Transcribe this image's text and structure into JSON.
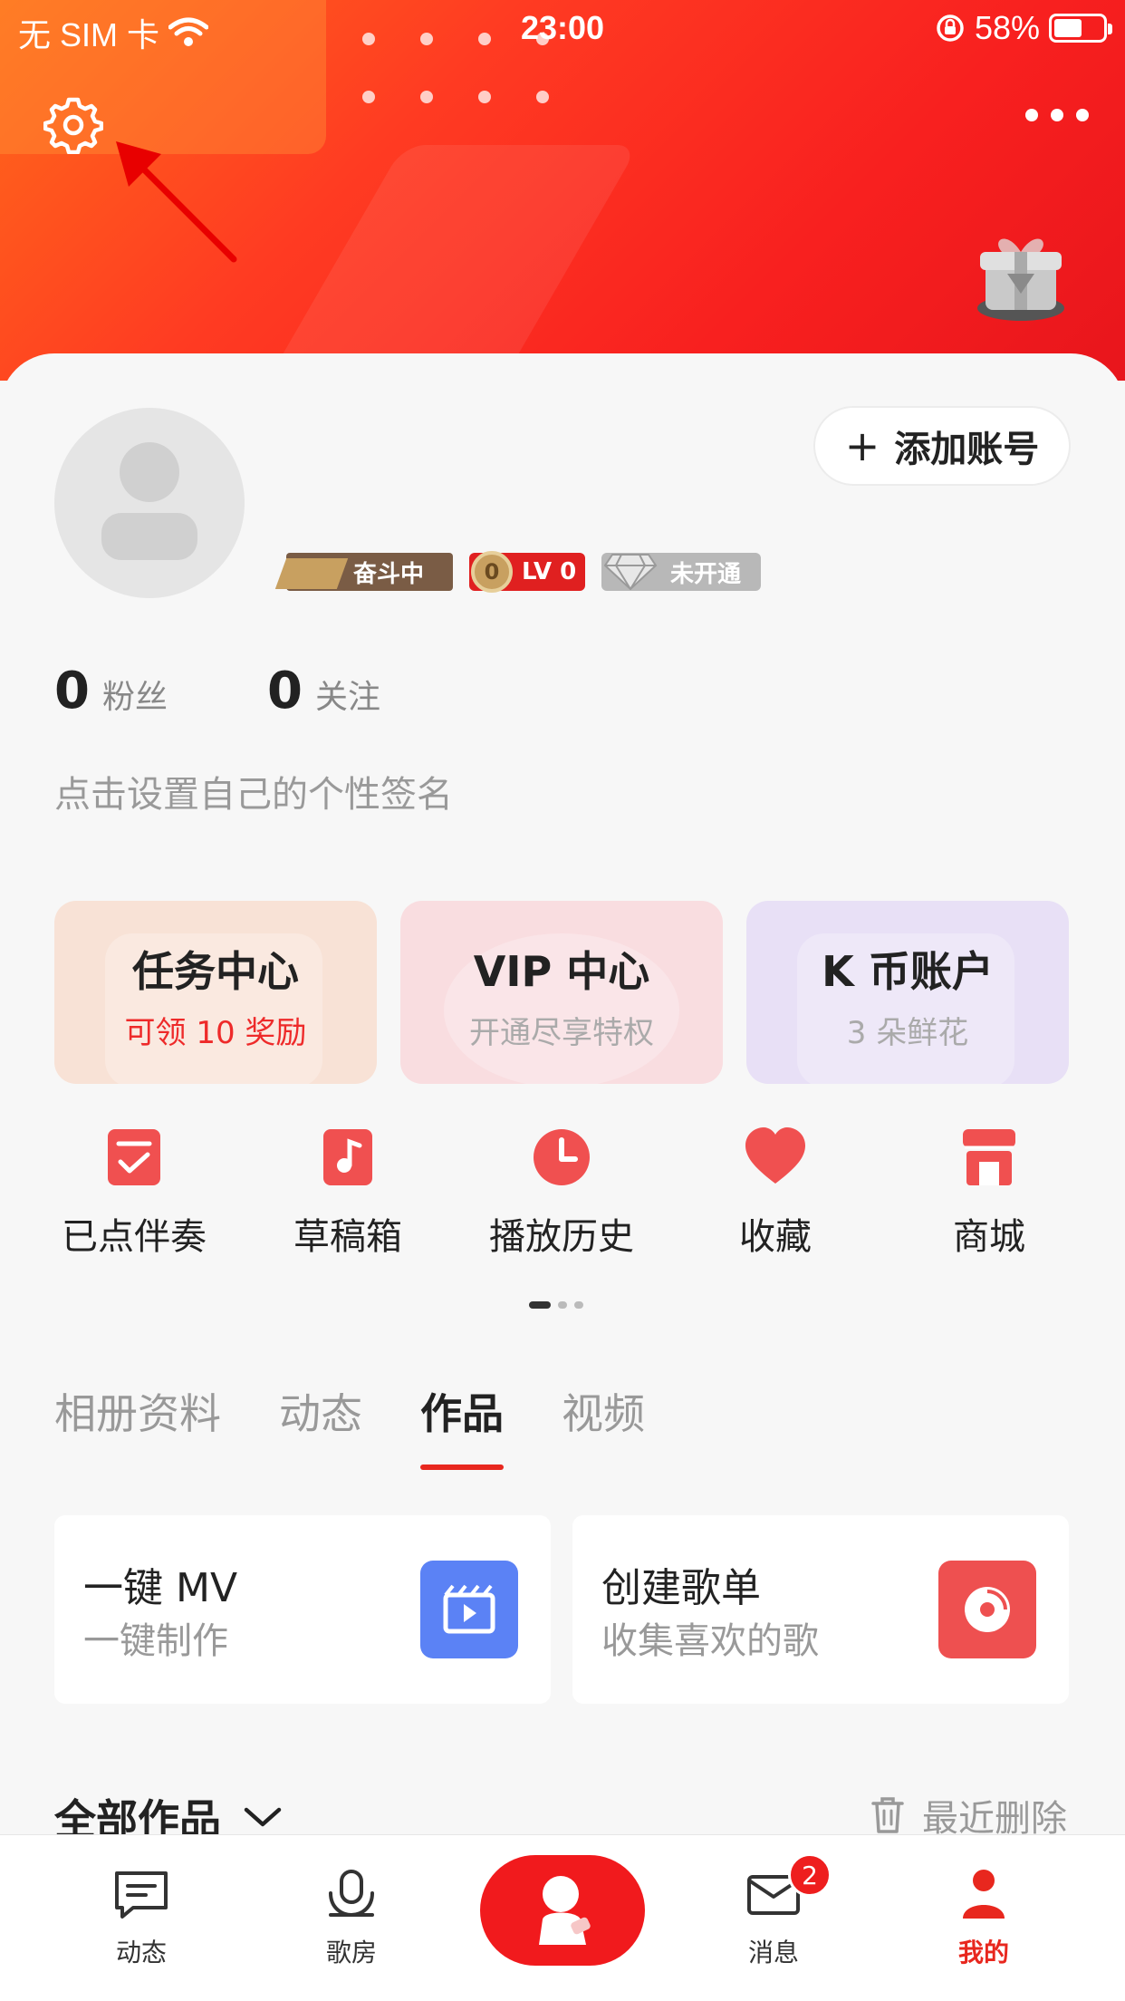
{
  "status_bar": {
    "carrier": "无 SIM 卡",
    "time": "23:00",
    "battery": "58%",
    "battery_level": 0.58
  },
  "profile": {
    "add_account": "添加账号",
    "badges": {
      "rank": "奋斗中",
      "level": "LV 0",
      "coin": "0",
      "vip": "未开通"
    },
    "stats": [
      {
        "value": "0",
        "label": "粉丝"
      },
      {
        "value": "0",
        "label": "关注"
      }
    ],
    "signature": "点击设置自己的个性签名"
  },
  "tiles": [
    {
      "title": "任务中心",
      "subtitle": "可领 10 奖励"
    },
    {
      "title": "VIP 中心",
      "subtitle": "开通尽享特权"
    },
    {
      "title": "K 币账户",
      "subtitle": "3 朵鲜花"
    }
  ],
  "shortcuts": [
    "已点伴奏",
    "草稿箱",
    "播放历史",
    "收藏",
    "商城"
  ],
  "tabs": [
    "相册资料",
    "动态",
    "作品",
    "视频"
  ],
  "actions": [
    {
      "title": "一键 MV",
      "subtitle": "一键制作"
    },
    {
      "title": "创建歌单",
      "subtitle": "收集喜欢的歌"
    }
  ],
  "works": {
    "title": "全部作品",
    "recent_deleted": "最近删除"
  },
  "nav": {
    "feed": "动态",
    "rooms": "歌房",
    "messages": "消息",
    "message_count": "2",
    "me": "我的"
  },
  "colors": {
    "accent": "#e8271e",
    "header_start": "#ff6a1a",
    "header_end": "#e8151c"
  }
}
